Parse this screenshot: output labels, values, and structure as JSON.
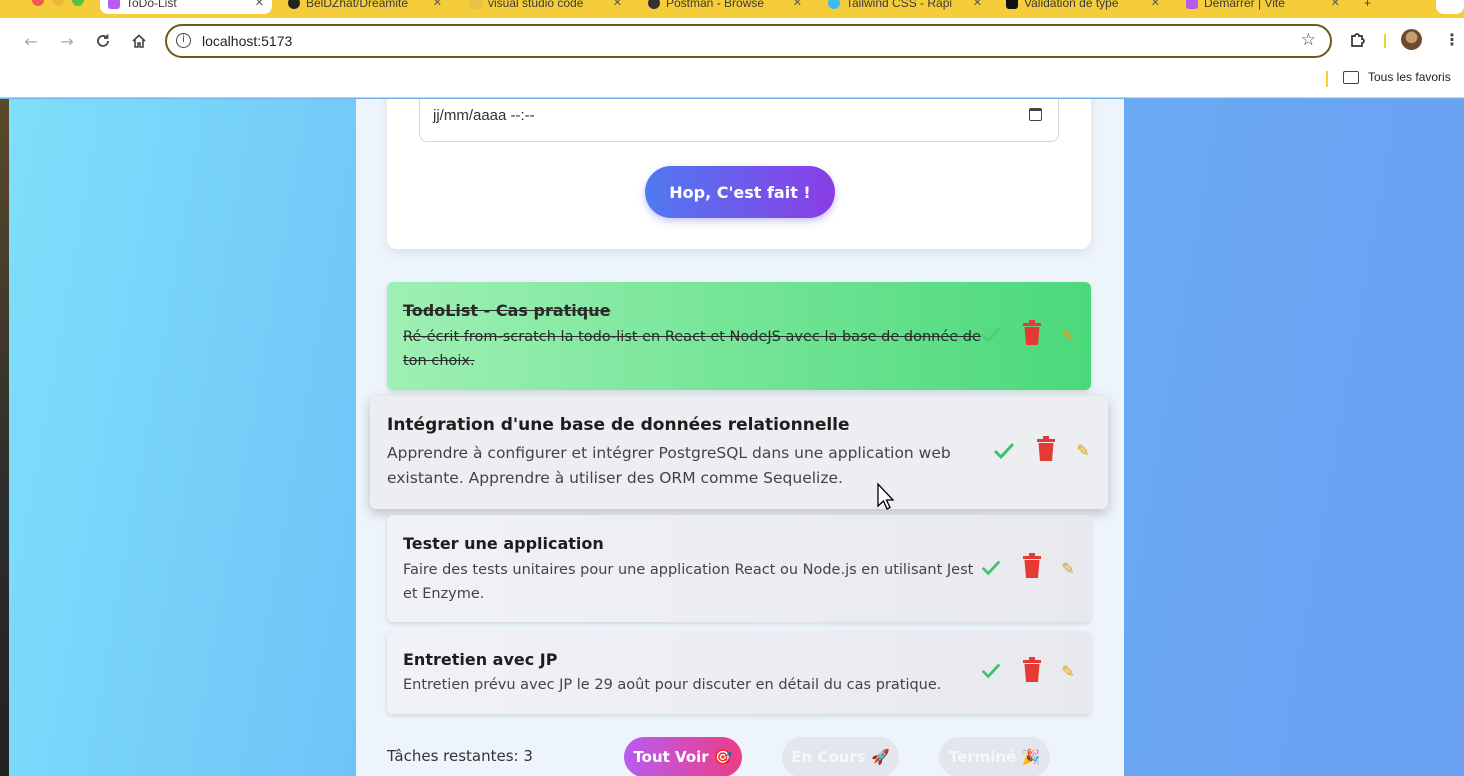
{
  "browser": {
    "tabs": [
      {
        "title": "ToDo-List",
        "favicon_color": "#b65cf0",
        "active": true
      },
      {
        "title": "BelDZhat/Dreamite",
        "favicon_color": "#222222",
        "active": false
      },
      {
        "title": "visual studio code",
        "favicon_color": "#e8c14a",
        "active": false
      },
      {
        "title": "Postman - Browse",
        "favicon_color": "#333333",
        "active": false
      },
      {
        "title": "Tailwind CSS - Rapi",
        "favicon_color": "#38bdf8",
        "active": false
      },
      {
        "title": "Validation de type",
        "favicon_color": "#111111",
        "active": false
      },
      {
        "title": "Démarrer | Vite",
        "favicon_color": "#b65cf0",
        "active": false
      }
    ],
    "url": "localhost:5173",
    "bookmarks_label": "Tous les favoris",
    "icons": {
      "back": "back-arrow-icon",
      "forward": "forward-arrow-icon",
      "reload": "reload-icon",
      "home": "home-icon",
      "star": "star-icon",
      "extensions": "puzzle-icon",
      "menu": "kebab-menu-icon",
      "folder": "folder-icon",
      "info": "info-icon"
    }
  },
  "form": {
    "date_placeholder": "jj/mm/aaaa --:--",
    "submit_label": "Hop, C'est fait !"
  },
  "tasks": [
    {
      "title": "TodoList - Cas pratique",
      "description": "Ré-écrit from-scratch la todo-list en React et NodeJS avec la base de donnée de ton choix.",
      "status": "done"
    },
    {
      "title": "Intégration d'une base de données relationnelle",
      "description": "Apprendre à configurer et intégrer PostgreSQL dans une application web existante. Apprendre à utiliser des ORM comme Sequelize.",
      "status": "dragging"
    },
    {
      "title": "Tester une application",
      "description": "Faire des tests unitaires pour une application React ou Node.js en utilisant Jest et Enzyme.",
      "status": "pending"
    },
    {
      "title": "Entretien avec JP",
      "description": "Entretien prévu avec JP le 29 août pour discuter en détail du cas pratique.",
      "status": "pending"
    }
  ],
  "footer": {
    "remaining_label": "Tâches restantes: 3",
    "filters": [
      "Tout Voir 🎯",
      "En Cours 🚀",
      "Terminé 🎉"
    ],
    "active_filter": "Tout Voir 🎯"
  },
  "colors": {
    "accent_gradient_start": "#4f7af0",
    "accent_gradient_end": "#8a3de6",
    "done_card": "#4ad97a",
    "check_green": "#3cc26a",
    "trash_red": "#e53935",
    "filter_active_start": "#b85cf0",
    "filter_active_end": "#ec3d86"
  }
}
